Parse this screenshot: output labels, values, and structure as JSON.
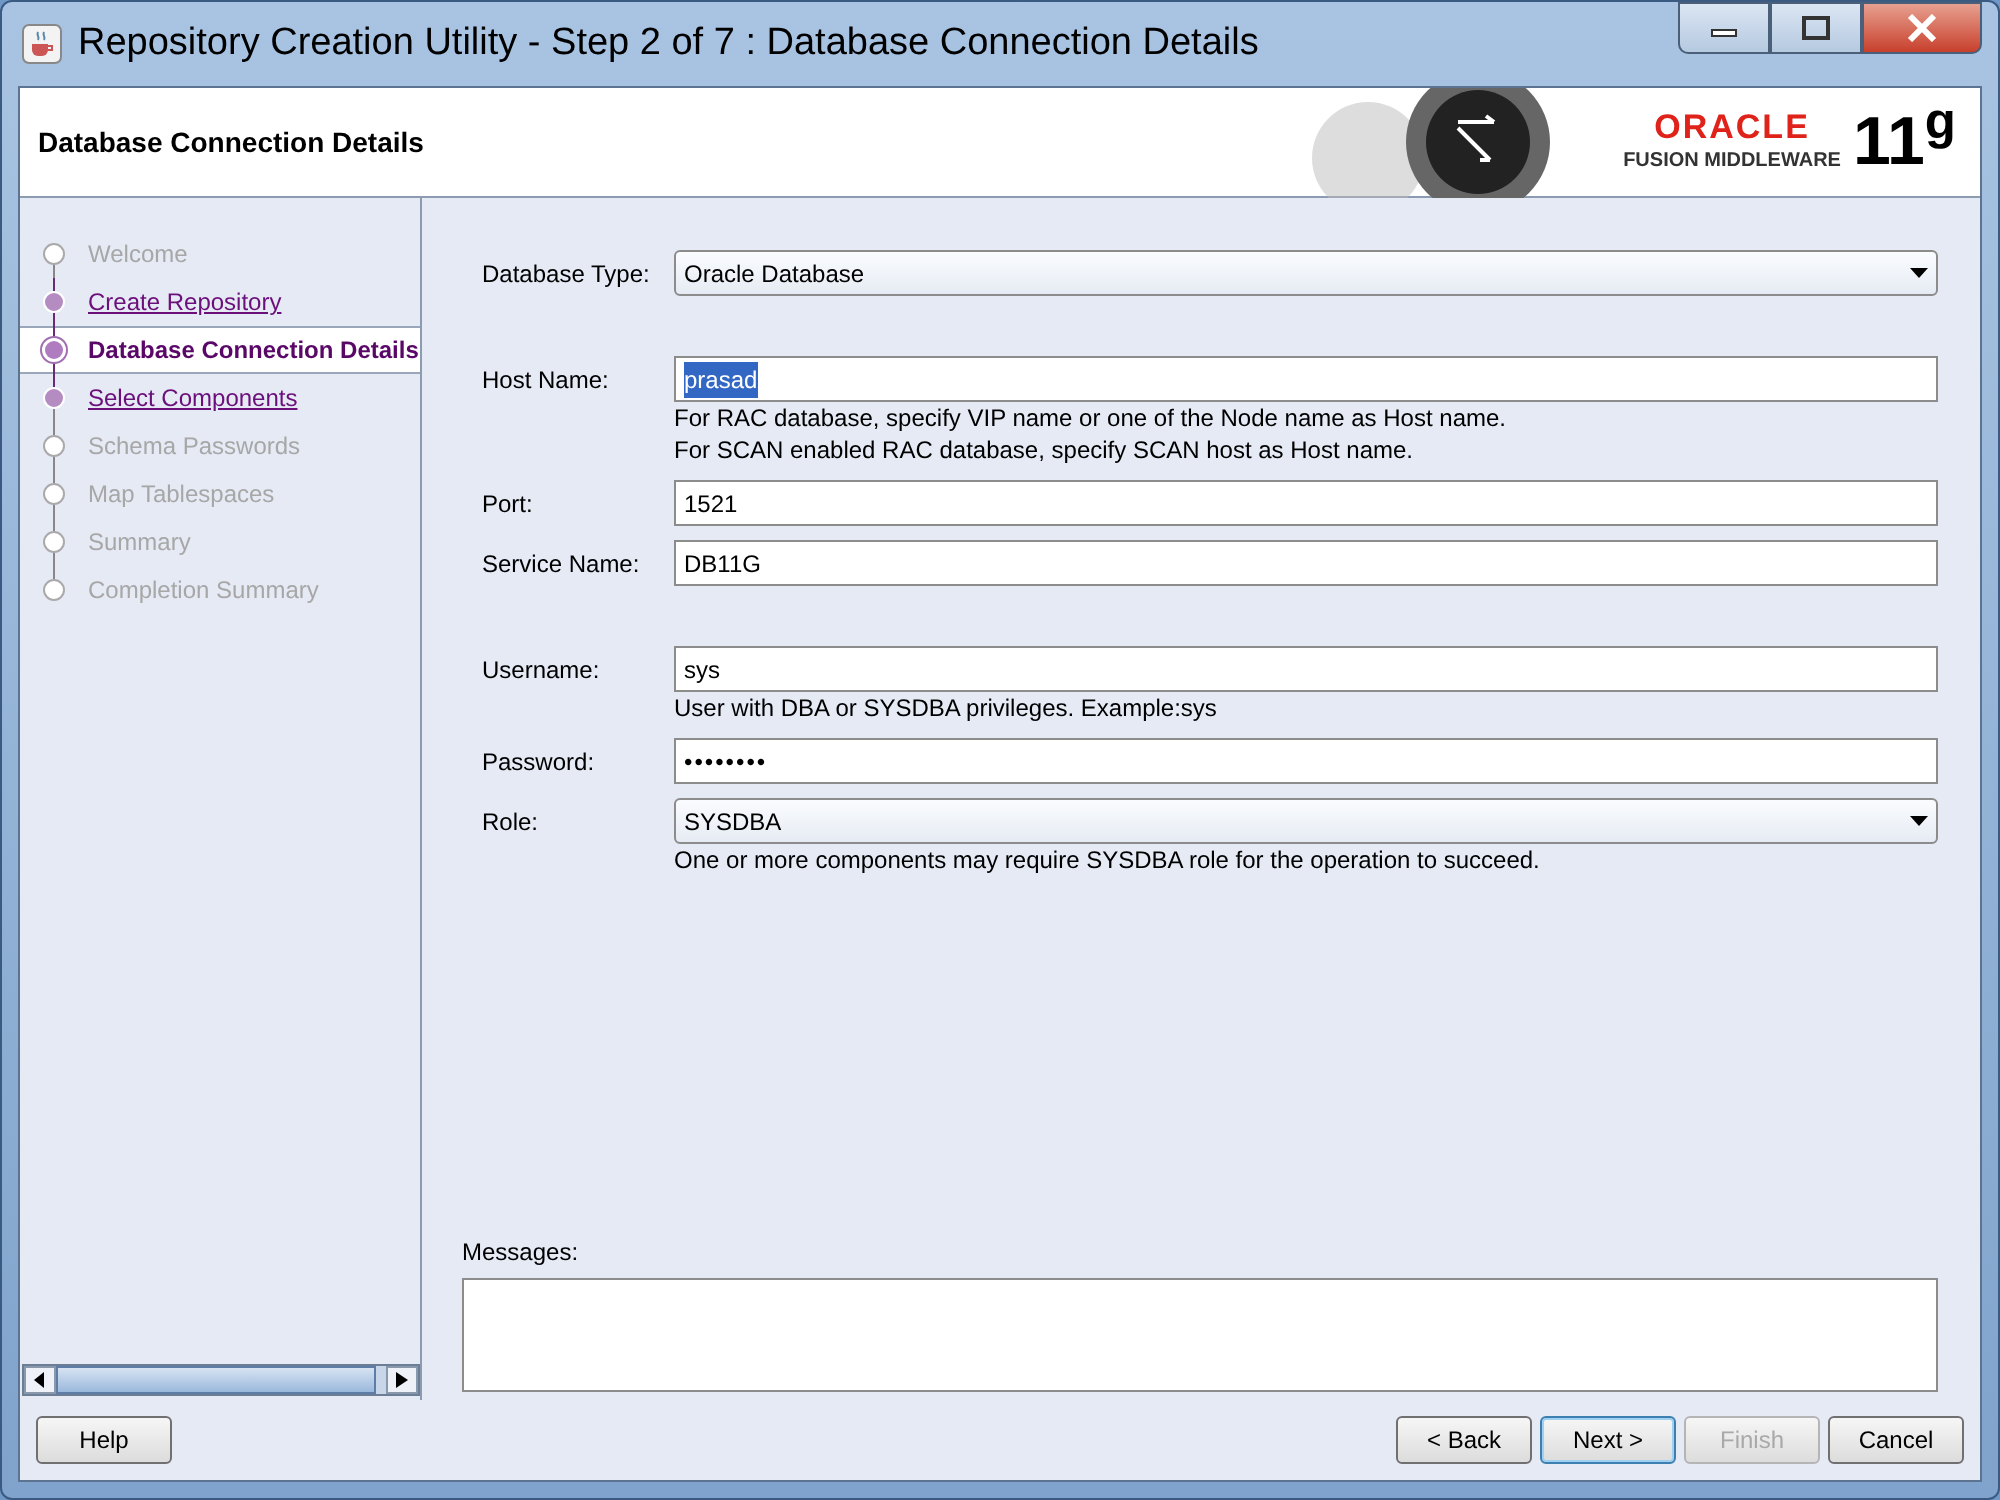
{
  "window": {
    "title": "Repository Creation Utility - Step 2 of 7 : Database Connection Details"
  },
  "header": {
    "title": "Database Connection Details",
    "brand": "ORACLE",
    "brand_sub": "FUSION MIDDLEWARE",
    "version": "11$^{g}$"
  },
  "steps": [
    {
      "label": "Welcome",
      "selected": false,
      "disabled": true
    },
    {
      "label": "Create Repository",
      "selected": false,
      "disabled": false
    },
    {
      "label": "Database Connection Details",
      "selected": true,
      "disabled": false
    },
    {
      "label": "Select Components",
      "selected": false,
      "disabled": false
    },
    {
      "label": "Schema Passwords",
      "selected": false,
      "disabled": true
    },
    {
      "label": "Map Tablespaces",
      "selected": false,
      "disabled": true
    },
    {
      "label": "Summary",
      "selected": false,
      "disabled": true
    },
    {
      "label": "Completion Summary",
      "selected": false,
      "disabled": true
    }
  ],
  "form": [
    {
      "kind": "select",
      "label": "Database Type:",
      "value": "Oracle Database",
      "gap_after": true
    },
    {
      "kind": "text",
      "label": "Host Name:",
      "value": "prasad",
      "selected_text": true,
      "hints": [
        "For RAC database, specify VIP name or one of the Node name as Host name.",
        "For SCAN enabled RAC database, specify SCAN host as Host name."
      ]
    },
    {
      "kind": "text",
      "label": "Port:",
      "value": "1521"
    },
    {
      "kind": "text",
      "label": "Service Name:",
      "value": "DB11G",
      "gap_after": true
    },
    {
      "kind": "text",
      "label": "Username:",
      "value": "sys",
      "hints": [
        "User with DBA or SYSDBA privileges. Example:sys"
      ]
    },
    {
      "kind": "password",
      "label": "Password:",
      "value": "••••••••"
    },
    {
      "kind": "select",
      "label": "Role:",
      "value": "SYSDBA",
      "hints": [
        "One or more components may require SYSDBA role for the operation to succeed."
      ]
    }
  ],
  "messages": {
    "label": "Messages:"
  },
  "buttons_left": [
    {
      "label": "Help",
      "disabled": false,
      "default": false
    }
  ],
  "buttons_right": [
    {
      "label": "< Back",
      "disabled": false,
      "default": false
    },
    {
      "label": "Next >",
      "disabled": false,
      "default": true
    },
    {
      "label": "Finish",
      "disabled": true,
      "default": false
    },
    {
      "label": "Cancel",
      "disabled": false,
      "default": false
    }
  ]
}
